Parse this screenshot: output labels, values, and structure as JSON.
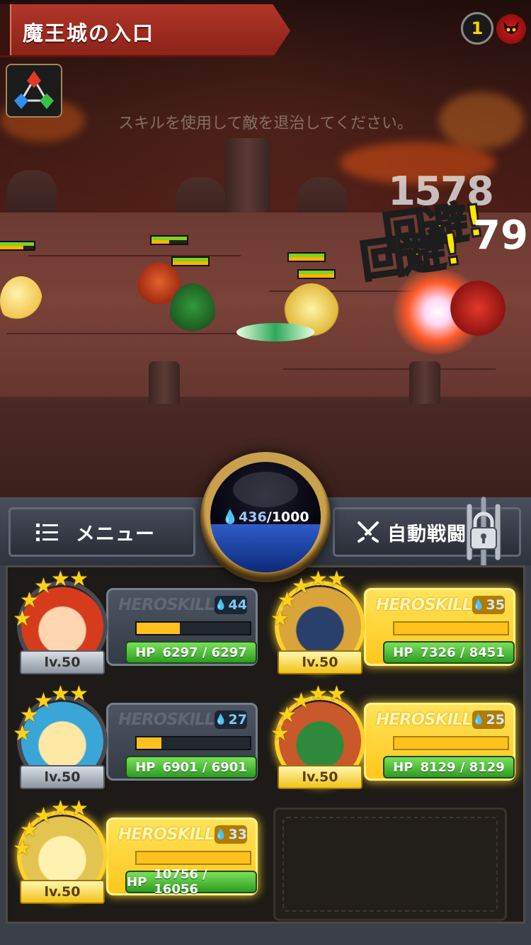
{
  "stage": {
    "title": "魔王城の入口",
    "wave": "1"
  },
  "hint": "スキルを使用して敵を退治してください。",
  "battle": {
    "damage_text": "1578",
    "damage_text2": "79",
    "evade_text": "回避!"
  },
  "menu": {
    "label": "メニュー"
  },
  "auto": {
    "label": "自動戦闘"
  },
  "mana": {
    "current": "436",
    "max": "/1000",
    "fill_ratio": 0.436
  },
  "colors": {
    "ready_gold": "#ffd22a",
    "hp_green": "#4cc33a",
    "mana_blue": "#2f5cc8",
    "title_red": "#b23628"
  },
  "heroes": [
    {
      "skill_label": "HEROSKILL",
      "cost": "44",
      "gauge": 0.38,
      "hp_label": "HP",
      "hp": "6297 / 6297",
      "level": "lv.50",
      "stars": 5,
      "ready": false,
      "portrait": "red-hair-girl-portrait"
    },
    {
      "skill_label": "HEROSKILL",
      "cost": "35",
      "gauge": 1.0,
      "hp_label": "HP",
      "hp": "7326 / 8451",
      "level": "lv.50",
      "stars": 5,
      "ready": true,
      "portrait": "dark-helmet-knight-portrait"
    },
    {
      "skill_label": "HEROSKILL",
      "cost": "27",
      "gauge": 0.22,
      "hp_label": "HP",
      "hp": "6901 / 6901",
      "level": "lv.50",
      "stars": 5,
      "ready": false,
      "portrait": "blonde-starfish-girl-portrait"
    },
    {
      "skill_label": "HEROSKILL",
      "cost": "25",
      "gauge": 1.0,
      "hp_label": "HP",
      "hp": "8129 / 8129",
      "level": "lv.50",
      "stars": 5,
      "ready": true,
      "portrait": "green-hat-archer-portrait"
    },
    {
      "skill_label": "HEROSKILL",
      "cost": "33",
      "gauge": 1.0,
      "hp_label": "HP",
      "hp": "10756 / 16056",
      "level": "lv.50",
      "stars": 5,
      "ready": true,
      "portrait": "blonde-knight-portrait"
    }
  ]
}
